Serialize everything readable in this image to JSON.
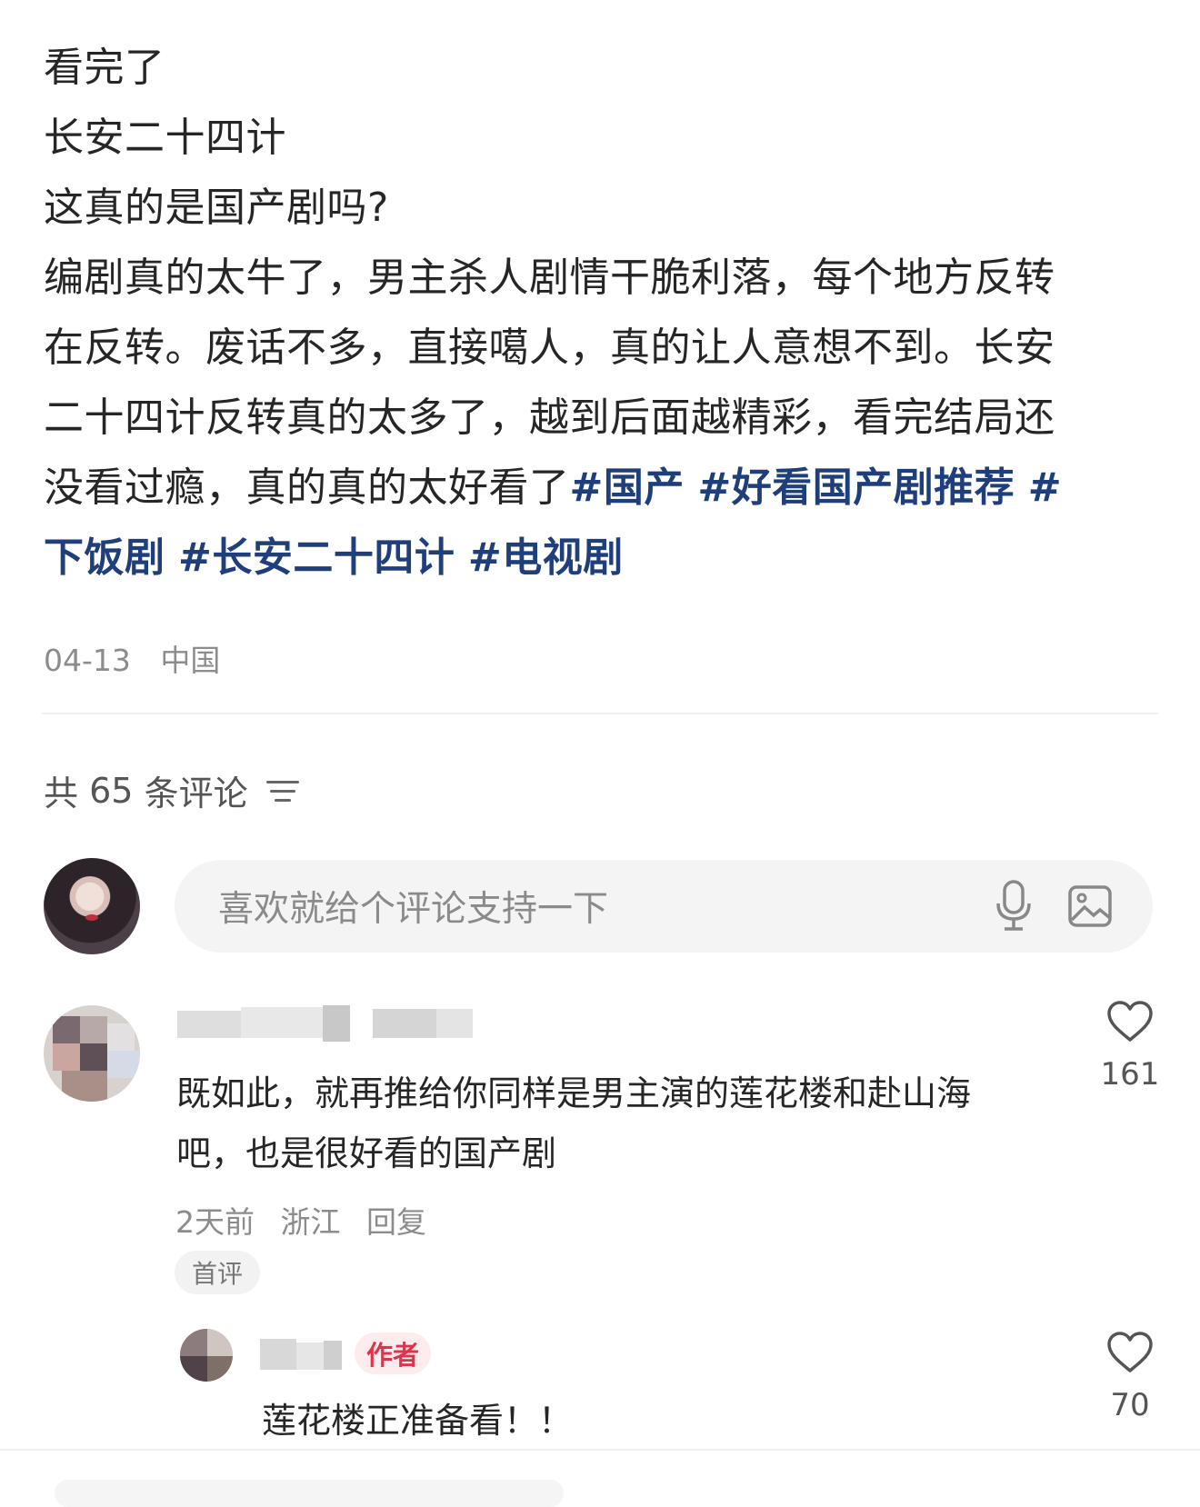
{
  "post": {
    "lines": [
      "看完了",
      "长安二十四计",
      "这真的是国产剧吗?"
    ],
    "body_line1": "编剧真的太牛了，男主杀人剧情干脆利落，每个地方反转",
    "body_line2": "在反转。废话不多，直接噶人，真的让人意想不到。长安",
    "body_line3": "二十四计反转真的太多了，越到后面越精彩，看完结局还",
    "body_line4_text": "没看过瘾，真的真的太好看了",
    "hashtags": [
      "#国产",
      "#好看国产剧推荐",
      "#下饭剧",
      "#长安二十四计",
      "#电视剧"
    ],
    "date": "04-13",
    "location": "中国"
  },
  "comments_header": {
    "prefix": "共",
    "count": "65",
    "suffix": "条评论"
  },
  "comment_input": {
    "placeholder": "喜欢就给个评论支持一下",
    "icons": [
      "mic-icon",
      "image-icon"
    ]
  },
  "comments": [
    {
      "text_line1": "既如此，就再推给你同样是男主演的莲花楼和赴山海",
      "text_line2": "吧，也是很好看的国产剧",
      "time": "2天前",
      "location": "浙江",
      "reply_label": "回复",
      "badge": "首评",
      "likes": "161"
    },
    {
      "author_tag": "作者",
      "text": "莲花楼正准备看！！",
      "likes": "70"
    }
  ],
  "colors": {
    "hashtag": "#1f3e7c",
    "author_tag": "#e0334b",
    "meta": "#8c8c8c"
  }
}
